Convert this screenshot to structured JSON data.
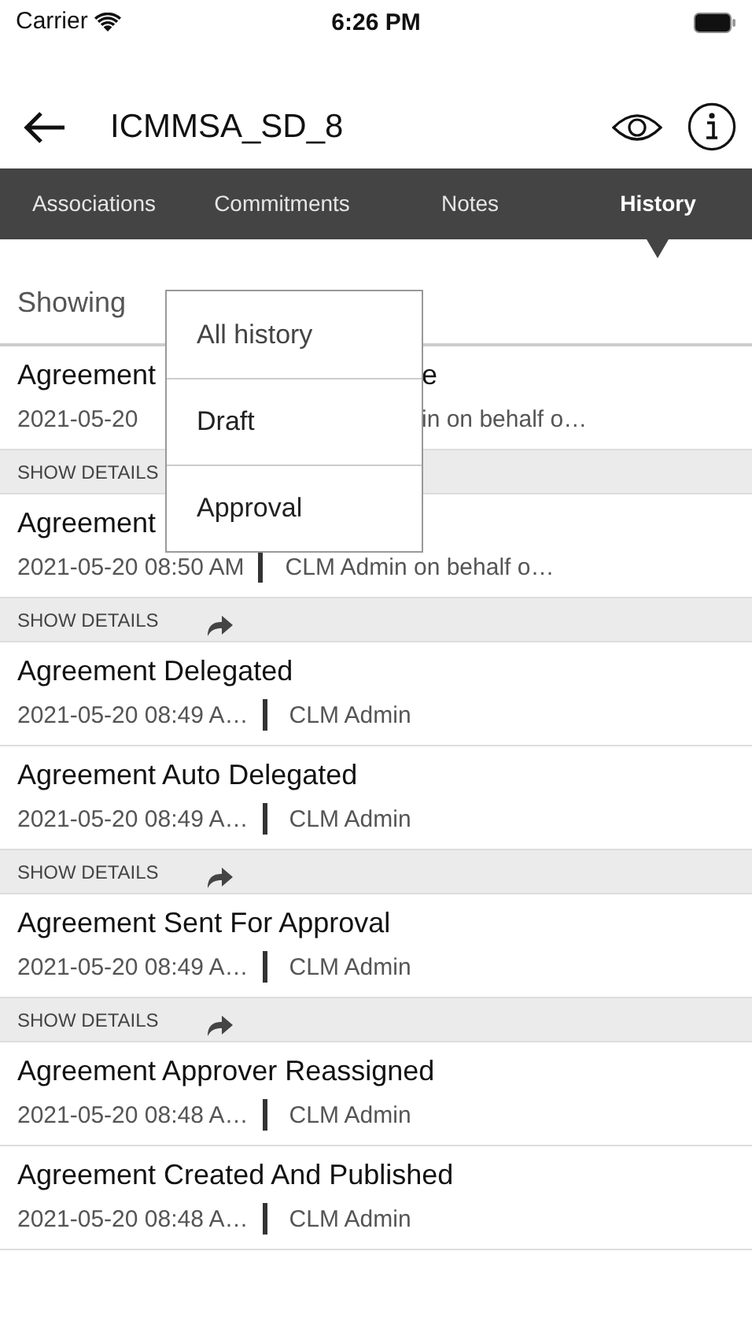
{
  "status_bar": {
    "carrier": "Carrier",
    "time": "6:26 PM"
  },
  "header": {
    "title": "ICMMSA_SD_8"
  },
  "tabs": [
    {
      "label": "Associations",
      "selected": false
    },
    {
      "label": "Commitments",
      "selected": false
    },
    {
      "label": "Notes",
      "selected": false
    },
    {
      "label": "History",
      "selected": true
    }
  ],
  "filter": {
    "label": "Showing"
  },
  "menu": {
    "items": [
      "All history",
      "Draft",
      "Approval"
    ]
  },
  "entries": [
    {
      "kind": "covered",
      "title_start": "Agreement",
      "title_end": "e",
      "date": "2021-05-20",
      "author_end": "in on behalf o…",
      "details": "SHOW DETAILS",
      "arrow": false
    },
    {
      "kind": "covered",
      "title_start": "Agreement",
      "date": "2021-05-20 08:50 AM",
      "author": "CLM Admin on behalf o…",
      "details": "SHOW DETAILS",
      "arrow": true
    },
    {
      "kind": "full",
      "title": "Agreement Delegated",
      "date": "2021-05-20 08:49 A…",
      "author": "CLM Admin"
    },
    {
      "kind": "full",
      "title": "Agreement Auto Delegated",
      "date": "2021-05-20 08:49 A…",
      "author": "CLM Admin",
      "details": "SHOW DETAILS",
      "arrow": true
    },
    {
      "kind": "full",
      "title": "Agreement Sent For Approval",
      "date": "2021-05-20 08:49 A…",
      "author": "CLM Admin",
      "details": "SHOW DETAILS",
      "arrow": true
    },
    {
      "kind": "full",
      "title": "Agreement Approver Reassigned",
      "date": "2021-05-20 08:48 A…",
      "author": "CLM Admin"
    },
    {
      "kind": "full",
      "title": "Agreement Created And Published",
      "date": "2021-05-20 08:48 A…",
      "author": "CLM Admin"
    }
  ]
}
